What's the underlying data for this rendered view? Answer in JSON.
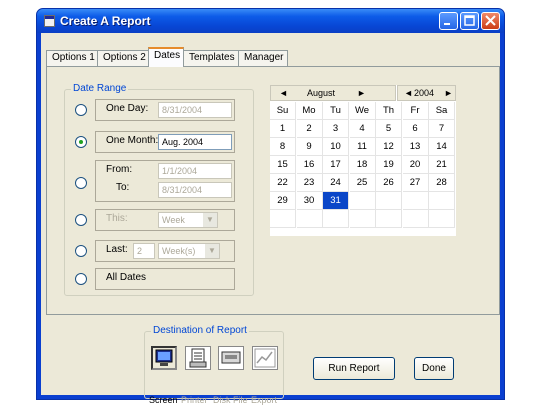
{
  "window": {
    "title": "Create A Report",
    "controls": [
      "minimize",
      "maximize",
      "close"
    ]
  },
  "tabs": [
    {
      "label": "Options 1",
      "selected": false
    },
    {
      "label": "Options 2",
      "selected": false
    },
    {
      "label": "Dates",
      "selected": true
    },
    {
      "label": "Templates",
      "selected": false
    },
    {
      "label": "Manager",
      "selected": false
    }
  ],
  "date_range": {
    "legend": "Date Range",
    "options": {
      "one_day": {
        "label": "One Day:",
        "value": "8/31/2004",
        "selected": false
      },
      "one_month": {
        "label": "One Month:",
        "value": "Aug. 2004",
        "selected": true
      },
      "from_to": {
        "from_label": "From:",
        "from_value": "1/1/2004",
        "to_label": "To:",
        "to_value": "8/31/2004",
        "selected": false
      },
      "this": {
        "label": "This:",
        "value": "Week",
        "selected": false
      },
      "last": {
        "label": "Last:",
        "count": "2",
        "unit": "Week(s)",
        "selected": false
      },
      "all_dates": {
        "label": "All Dates",
        "selected": false
      }
    }
  },
  "calendar": {
    "month": "August",
    "year": "2004",
    "prev_month": "◄",
    "next_month": "►",
    "prev_year": "◄",
    "next_year": "►",
    "weekdays": [
      "Su",
      "Mo",
      "Tu",
      "We",
      "Th",
      "Fr",
      "Sa"
    ],
    "weeks": [
      [
        "1",
        "2",
        "3",
        "4",
        "5",
        "6",
        "7"
      ],
      [
        "8",
        "9",
        "10",
        "11",
        "12",
        "13",
        "14"
      ],
      [
        "15",
        "16",
        "17",
        "18",
        "19",
        "20",
        "21"
      ],
      [
        "22",
        "23",
        "24",
        "25",
        "26",
        "27",
        "28"
      ],
      [
        "29",
        "30",
        "31",
        "",
        "",
        "",
        ""
      ],
      [
        "",
        "",
        "",
        "",
        "",
        "",
        ""
      ]
    ],
    "selected_day": "31"
  },
  "destination": {
    "legend": "Destination of Report",
    "items": [
      {
        "label": "Screen",
        "icon": "monitor-icon",
        "selected": true
      },
      {
        "label": "Printer",
        "icon": "printer-icon",
        "selected": false
      },
      {
        "label": "Disk File",
        "icon": "disk-file-icon",
        "selected": false
      },
      {
        "label": "Export",
        "icon": "export-chart-icon",
        "selected": false
      }
    ]
  },
  "buttons": {
    "run_report": "Run Report",
    "done": "Done"
  }
}
